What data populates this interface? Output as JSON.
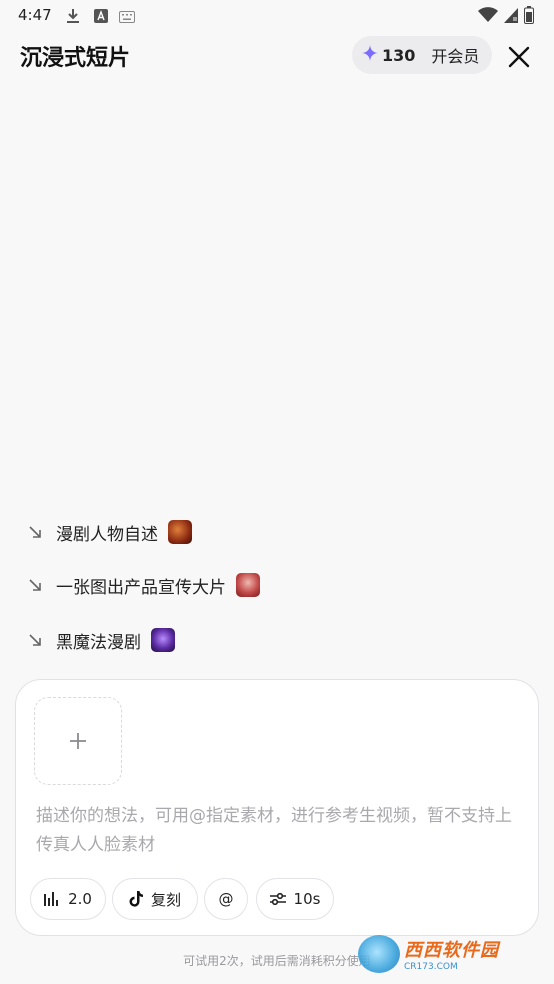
{
  "status_bar": {
    "time": "4:47"
  },
  "header": {
    "title": "沉浸式短片",
    "credits": "130",
    "vip_label": "开会员"
  },
  "suggestions": [
    {
      "label": "漫剧人物自述"
    },
    {
      "label": "一张图出产品宣传大片"
    },
    {
      "label": "黑魔法漫剧"
    }
  ],
  "composer": {
    "placeholder": "描述你的想法，可用@指定素材，进行参考生视频，暂不支持上传真人人脸素材",
    "chips": {
      "model": "2.0",
      "style": "复刻",
      "mention": "@",
      "duration": "10s"
    }
  },
  "footer_note": "可试用2次，试用后需消耗积分使用",
  "watermark": {
    "main": "西西软件园",
    "sub": "CR173.COM"
  },
  "colors": {
    "accent_star": "#7b6cff",
    "background": "#f8f8f9",
    "pill": "#ececef"
  }
}
